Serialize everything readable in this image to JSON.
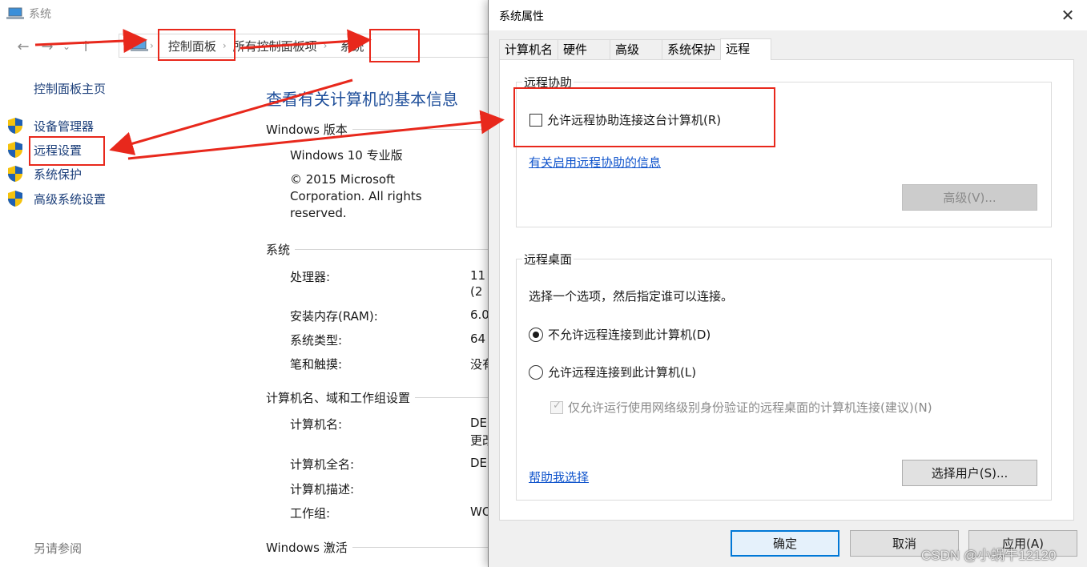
{
  "window": {
    "title": "系统"
  },
  "breadcrumb": {
    "items": [
      "控制面板",
      "所有控制面板项",
      "系统"
    ]
  },
  "left_pane": {
    "home": "控制面板主页",
    "tasks": [
      "设备管理器",
      "远程设置",
      "系统保护",
      "高级系统设置"
    ],
    "see_also": "另请参阅"
  },
  "content": {
    "title": "查看有关计算机的基本信息",
    "windows_edition": {
      "header": "Windows 版本",
      "name": "Windows 10 专业版",
      "copyright": "© 2015 Microsoft Corporation. All rights reserved."
    },
    "system": {
      "header": "系统",
      "rows": [
        {
          "label": "处理器:",
          "value": "11",
          "value2": "(2"
        },
        {
          "label": "安装内存(RAM):",
          "value": "6.0"
        },
        {
          "label": "系统类型:",
          "value": "64"
        },
        {
          "label": "笔和触摸:",
          "value": "没有"
        }
      ]
    },
    "computer": {
      "header": "计算机名、域和工作组设置",
      "rows": [
        {
          "label": "计算机名:",
          "value": "DE",
          "value2": "更改"
        },
        {
          "label": "计算机全名:",
          "value": "DE"
        },
        {
          "label": "计算机描述:",
          "value": ""
        },
        {
          "label": "工作组:",
          "value": "WO"
        }
      ]
    },
    "activation": {
      "header": "Windows 激活"
    }
  },
  "dialog": {
    "title": "系统属性",
    "close": "✕",
    "tabs": [
      "计算机名",
      "硬件",
      "高级",
      "系统保护",
      "远程"
    ],
    "active_tab": "远程",
    "remote_assistance": {
      "label": "远程协助",
      "allow_checkbox": "允许远程协助连接这台计算机(R)",
      "allow_checked": false,
      "info_link": "有关启用远程协助的信息",
      "advanced_button": "高级(V)..."
    },
    "remote_desktop": {
      "label": "远程桌面",
      "instruction": "选择一个选项，然后指定谁可以连接。",
      "option_deny": "不允许远程连接到此计算机(D)",
      "option_allow": "允许远程连接到此计算机(L)",
      "selected": "deny",
      "nla_checkbox": "仅允许运行使用网络级别身份验证的远程桌面的计算机连接(建议)(N)",
      "help_link": "帮助我选择",
      "select_users_button": "选择用户(S)..."
    },
    "buttons": {
      "ok": "确定",
      "cancel": "取消",
      "apply": "应用(A)"
    }
  },
  "watermark": "CSDN @小蜗牛12120",
  "annotation_color": "#e8281c"
}
